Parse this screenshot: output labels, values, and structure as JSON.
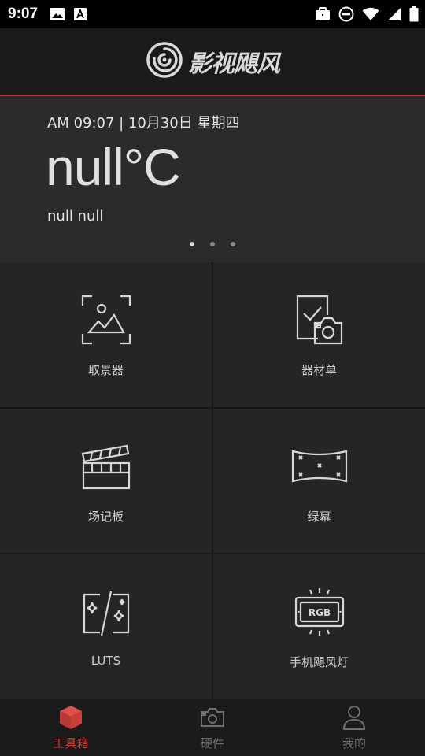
{
  "status_bar": {
    "time": "9:07",
    "left_icons": [
      "image-icon",
      "text-a-icon"
    ],
    "right_icons": [
      "briefcase-icon",
      "do-not-disturb-icon",
      "wifi-icon",
      "signal-icon",
      "battery-icon"
    ]
  },
  "header": {
    "brand_name": "影视飓风",
    "logo_icon": "swirl-logo-icon",
    "accent_color": "#c1343b"
  },
  "weather": {
    "datetime": "AM 09:07 | 10月30日 星期四",
    "temperature": "null°C",
    "description": "null null",
    "pager": {
      "count": 3,
      "active_index": 0
    }
  },
  "tools": [
    {
      "label": "取景器",
      "icon": "viewfinder-icon"
    },
    {
      "label": "器材单",
      "icon": "equipment-list-icon"
    },
    {
      "label": "场记板",
      "icon": "clapperboard-icon"
    },
    {
      "label": "绿幕",
      "icon": "green-screen-icon"
    },
    {
      "label": "LUTS",
      "icon": "luts-icon"
    },
    {
      "label": "手机飓风灯",
      "icon": "rgb-light-icon"
    }
  ],
  "bottom_nav": {
    "items": [
      {
        "label": "工具箱",
        "icon": "cube-icon",
        "active": true
      },
      {
        "label": "硬件",
        "icon": "camera-icon",
        "active": false
      },
      {
        "label": "我的",
        "icon": "person-icon",
        "active": false
      }
    ],
    "active_color": "#c9403a"
  }
}
